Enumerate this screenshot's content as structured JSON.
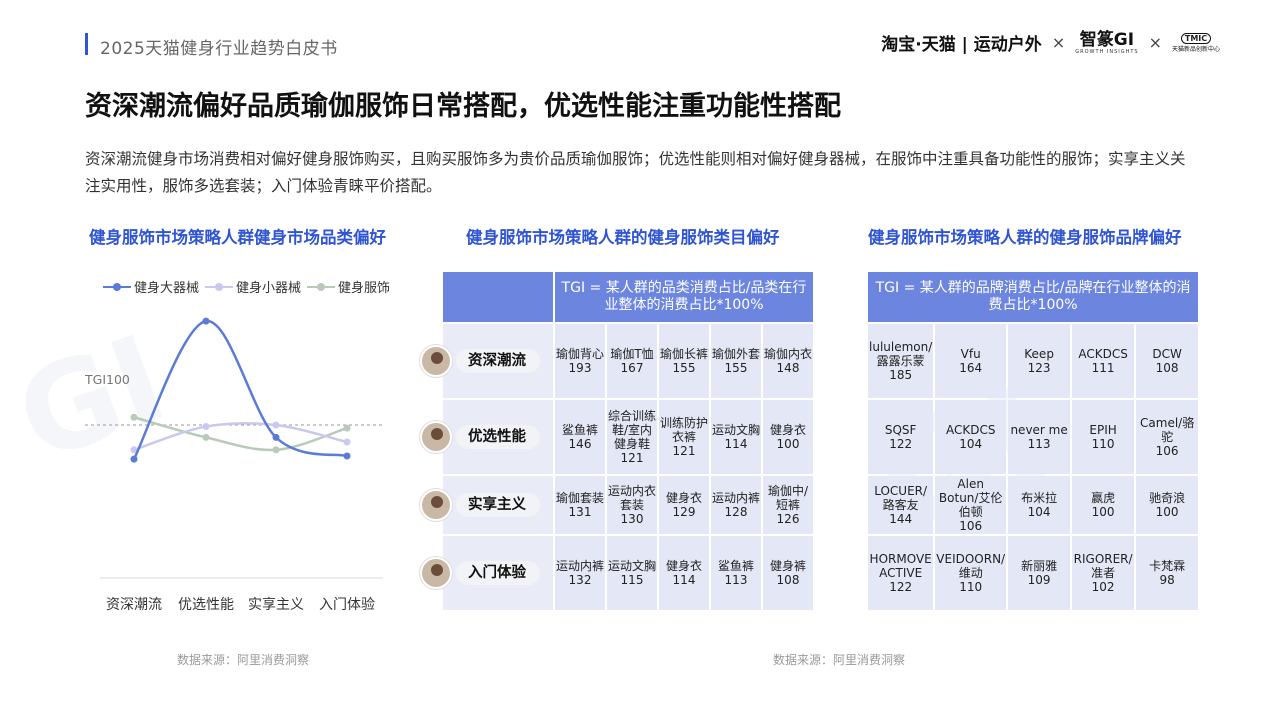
{
  "header": {
    "report_title": "2025天猫健身行业趋势白皮书",
    "logo_tmall": "淘宝·天猫 | 运动户外",
    "logo_sep": "×",
    "logo_zhixiang": "智篆GI",
    "logo_zhixiang_sub": "GROWTH INSIGHTS",
    "logo_tmic": "TMIC",
    "logo_tmic_sub": "天猫新品创新中心"
  },
  "main_title": "资深潮流偏好品质瑜伽服饰日常搭配，优选性能注重功能性搭配",
  "intro": "资深潮流健身市场消费相对偏好健身服饰购买，且购买服饰多为贵价品质瑜伽服饰；优选性能则相对偏好健身器械，在服饰中注重具备功能性的服饰；实享主义关注实用性，服饰多选套装；入门体验青睐平价搭配。",
  "sections": {
    "left_title": "健身服饰市场策略人群健身市场品类偏好",
    "mid_title": "健身服饰市场策略人群的健身服饰类目偏好",
    "right_title": "健身服饰市场策略人群的健身服饰品牌偏好"
  },
  "chart_data": {
    "type": "line",
    "categories": [
      "资深潮流",
      "优选性能",
      "实享主义",
      "入门体验"
    ],
    "reference_line": {
      "label": "TGI100",
      "value": 100
    },
    "ylim": [
      0,
      200
    ],
    "series": [
      {
        "name": "健身大器械",
        "color": "#5a7bd6",
        "values": [
          78,
          167,
          92,
          80
        ]
      },
      {
        "name": "健身小器械",
        "color": "#c9c8f0",
        "values": [
          84,
          99,
          100,
          89
        ]
      },
      {
        "name": "健身服饰",
        "color": "#b8cbb8",
        "values": [
          105,
          92,
          84,
          98
        ]
      }
    ],
    "legend_position": "top-left",
    "grid": false
  },
  "category_table": {
    "header": "TGI = 某人群的品类消费占比/品类在行业整体的消费占比*100%",
    "rows": [
      {
        "label": "资深潮流",
        "cells": [
          [
            "瑜伽背心",
            "193"
          ],
          [
            "瑜伽T恤",
            "167"
          ],
          [
            "瑜伽长裤",
            "155"
          ],
          [
            "瑜伽外套",
            "155"
          ],
          [
            "瑜伽内衣",
            "148"
          ]
        ]
      },
      {
        "label": "优选性能",
        "cells": [
          [
            "鲨鱼裤",
            "146"
          ],
          [
            "综合训练鞋/室内健身鞋",
            "121"
          ],
          [
            "训练防护衣裤",
            "121"
          ],
          [
            "运动文胸",
            "114"
          ],
          [
            "健身衣",
            "100"
          ]
        ]
      },
      {
        "label": "实享主义",
        "cells": [
          [
            "瑜伽套装",
            "131"
          ],
          [
            "运动内衣套装",
            "130"
          ],
          [
            "健身衣",
            "129"
          ],
          [
            "运动内裤",
            "128"
          ],
          [
            "瑜伽中/短裤",
            "126"
          ]
        ]
      },
      {
        "label": "入门体验",
        "cells": [
          [
            "运动内裤",
            "132"
          ],
          [
            "运动文胸",
            "115"
          ],
          [
            "健身衣",
            "114"
          ],
          [
            "鲨鱼裤",
            "113"
          ],
          [
            "健身裤",
            "108"
          ]
        ]
      }
    ]
  },
  "brand_table": {
    "header": "TGI = 某人群的品牌消费占比/品牌在行业整体的消费占比*100%",
    "rows": [
      {
        "cells": [
          [
            "lululemon/露露乐蒙",
            "185"
          ],
          [
            "Vfu",
            "164"
          ],
          [
            "Keep",
            "123"
          ],
          [
            "ACKDCS",
            "111"
          ],
          [
            "DCW",
            "108"
          ]
        ]
      },
      {
        "cells": [
          [
            "SQSF",
            "122"
          ],
          [
            "ACKDCS",
            "104"
          ],
          [
            "never me",
            "113"
          ],
          [
            "EPIH",
            "110"
          ],
          [
            "Camel/骆驼",
            "106"
          ]
        ]
      },
      {
        "cells": [
          [
            "LOCUER/路客友",
            "144"
          ],
          [
            "Alen Botun/艾伦伯顿",
            "106"
          ],
          [
            "布米拉",
            "104"
          ],
          [
            "赢虎",
            "100"
          ],
          [
            "驰奇浪",
            "100"
          ]
        ]
      },
      {
        "cells": [
          [
            "HORMOVE ACTIVE",
            "122"
          ],
          [
            "VEIDOORN/维动",
            "110"
          ],
          [
            "新丽雅",
            "109"
          ],
          [
            "RIGORER/准者",
            "102"
          ],
          [
            "卡梵霖",
            "98"
          ]
        ]
      }
    ]
  },
  "sources": {
    "left": "数据来源：阿里消费洞察",
    "right": "数据来源：阿里消费洞察"
  }
}
